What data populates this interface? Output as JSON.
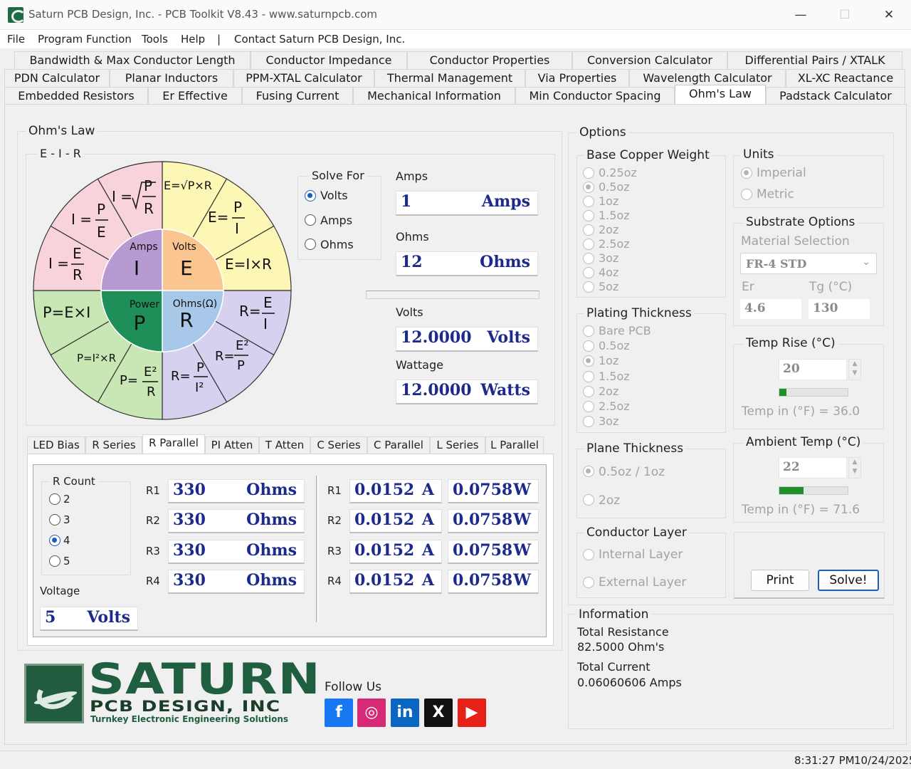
{
  "window": {
    "title": "Saturn PCB Design, Inc. - PCB Toolkit V8.43 - www.saturnpcb.com",
    "min": "—",
    "max": "☐",
    "close": "✕"
  },
  "menu": [
    "File",
    "Program Function",
    "Tools",
    "Help",
    "|",
    "Contact Saturn PCB Design, Inc."
  ],
  "tabs": {
    "row1": [
      "Bandwidth & Max Conductor Length",
      "Conductor Impedance",
      "Conductor Properties",
      "Conversion Calculator",
      "Differential Pairs / XTALK"
    ],
    "row2": [
      "PDN Calculator",
      "Planar Inductors",
      "PPM-XTAL Calculator",
      "Thermal Management",
      "Via Properties",
      "Wavelength Calculator",
      "XL-XC Reactance"
    ],
    "row3": [
      "Embedded Resistors",
      "Er Effective",
      "Fusing Current",
      "Mechanical Information",
      "Min Conductor Spacing",
      "Ohm's Law",
      "Padstack Calculator"
    ]
  },
  "ohms_law": {
    "group_label": "Ohm's Law",
    "eir_label": "E - I - R",
    "wheel": {
      "amps": "Amps",
      "I": "I",
      "volts": "Volts",
      "E": "E",
      "power": "Power",
      "P": "P",
      "ohms": "Ohms(Ω)",
      "R": "R",
      "i_sqrt": "I =",
      "i_pe_p": "P",
      "i_pe_e": "E",
      "i_pe_lhs": "I =",
      "i_er_lhs": "I =",
      "i_er_e": "E",
      "i_er_r": "R",
      "i_sqrt_p": "P",
      "i_sqrt_r": "R",
      "e_sqrt": "E=√P×R",
      "e_pi_lhs": "E=",
      "e_pi_p": "P",
      "e_pi_i": "I",
      "e_ir": "E=I×R",
      "r_ei_lhs": "R=",
      "r_ei_e": "E",
      "r_ei_i": "I",
      "r_ep_lhs": "R=",
      "r_ep_e": "E²",
      "r_ep_p": "P",
      "r_pi_lhs": "R=",
      "r_pi_p": "P",
      "r_pi_i": "I²",
      "p_er_lhs": "P=",
      "p_er_e": "E²",
      "p_er_r": "R",
      "p_i2r": "P=I²×R",
      "p_ei": "P=E×I"
    },
    "solve_for": {
      "label": "Solve For",
      "options": [
        "Volts",
        "Amps",
        "Ohms"
      ],
      "selected": "Volts"
    },
    "amps": {
      "label": "Amps",
      "value": "1",
      "unit": "Amps"
    },
    "ohms": {
      "label": "Ohms",
      "value": "12",
      "unit": "Ohms"
    },
    "volts": {
      "label": "Volts",
      "value": "12.0000",
      "unit": "Volts"
    },
    "wattage": {
      "label": "Wattage",
      "value": "12.0000",
      "unit": "Watts"
    }
  },
  "subtabs": [
    "LED Bias",
    "R Series",
    "R Parallel",
    "PI Atten",
    "T Atten",
    "C Series",
    "C Parallel",
    "L Series",
    "L Parallel"
  ],
  "r_parallel": {
    "r_count": {
      "label": "R Count",
      "options": [
        "2",
        "3",
        "4",
        "5"
      ],
      "selected": "4"
    },
    "voltage": {
      "label": "Voltage",
      "value": "5",
      "unit": "Volts"
    },
    "resistors": [
      {
        "label": "R1",
        "value": "330",
        "unit": "Ohms",
        "amps": "0.0152",
        "amps_unit": "A",
        "watts": "0.0758",
        "watts_unit": "W"
      },
      {
        "label": "R2",
        "value": "330",
        "unit": "Ohms",
        "amps": "0.0152",
        "amps_unit": "A",
        "watts": "0.0758",
        "watts_unit": "W"
      },
      {
        "label": "R3",
        "value": "330",
        "unit": "Ohms",
        "amps": "0.0152",
        "amps_unit": "A",
        "watts": "0.0758",
        "watts_unit": "W"
      },
      {
        "label": "R4",
        "value": "330",
        "unit": "Ohms",
        "amps": "0.0152",
        "amps_unit": "A",
        "watts": "0.0758",
        "watts_unit": "W"
      }
    ]
  },
  "options": {
    "label": "Options",
    "base_copper": {
      "label": "Base Copper Weight",
      "options": [
        "0.25oz",
        "0.5oz",
        "1oz",
        "1.5oz",
        "2oz",
        "2.5oz",
        "3oz",
        "4oz",
        "5oz"
      ],
      "selected": "0.5oz"
    },
    "plating": {
      "label": "Plating Thickness",
      "options": [
        "Bare PCB",
        "0.5oz",
        "1oz",
        "1.5oz",
        "2oz",
        "2.5oz",
        "3oz"
      ],
      "selected": "1oz"
    },
    "plane": {
      "label": "Plane Thickness",
      "options": [
        "0.5oz / 1oz",
        "2oz"
      ],
      "selected": "0.5oz / 1oz"
    },
    "conductor_layer": {
      "label": "Conductor Layer",
      "options": [
        "Internal Layer",
        "External Layer"
      ]
    },
    "units": {
      "label": "Units",
      "options": [
        "Imperial",
        "Metric"
      ],
      "selected": "Imperial"
    },
    "substrate": {
      "label": "Substrate Options",
      "material_label": "Material Selection",
      "material": "FR-4 STD",
      "er_label": "Er",
      "er": "4.6",
      "tg_label": "Tg (°C)",
      "tg": "130"
    },
    "temp_rise": {
      "label": "Temp Rise (°C)",
      "value": "20",
      "progress": 0.1,
      "readout": "Temp in (°F) = 36.0"
    },
    "ambient": {
      "label": "Ambient Temp (°C)",
      "value": "22",
      "progress": 0.35,
      "readout": "Temp in (°F) = 71.6"
    },
    "print": "Print",
    "solve": "Solve!"
  },
  "information": {
    "label": "Information",
    "total_resistance_label": "Total Resistance",
    "total_resistance": "82.5000 Ohm's",
    "total_current_label": "Total Current",
    "total_current": "0.06060606 Amps"
  },
  "logo": {
    "line1": "SATURN",
    "line2": "PCB DESIGN, INC",
    "line3": "Turnkey Electronic Engineering Solutions"
  },
  "follow": {
    "label": "Follow Us",
    "icons": [
      "f",
      "◎",
      "in",
      "X",
      "▶"
    ]
  },
  "status": {
    "time": "8:31:27 PM",
    "date": "10/24/2025"
  },
  "colors": {
    "pink": "#f9d3dc",
    "yellow": "#fdf7b6",
    "green": "#c9e7b4",
    "lavender": "#d5d1ee",
    "purple": "#b79ad1",
    "orange": "#fbc58f",
    "darkgreen": "#1f8f5a",
    "blue": "#a8c8ea",
    "facebook": "#1877f2",
    "instagram": "#d62976",
    "linkedin": "#0a66c2",
    "x": "#111111",
    "youtube": "#e62117"
  }
}
